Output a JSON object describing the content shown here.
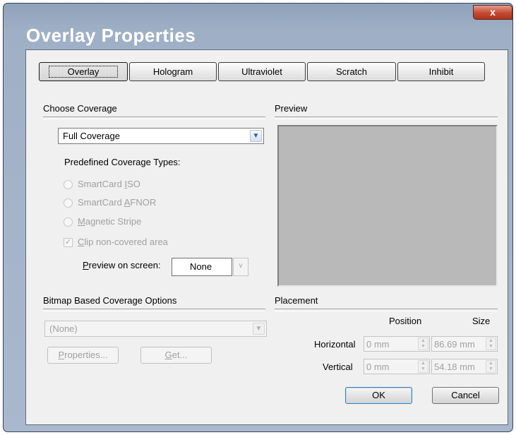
{
  "window": {
    "title": "Overlay Properties",
    "close_glyph": "x"
  },
  "tabs": [
    {
      "label": "Overlay",
      "active": true
    },
    {
      "label": "Hologram",
      "active": false
    },
    {
      "label": "Ultraviolet",
      "active": false
    },
    {
      "label": "Scratch",
      "active": false
    },
    {
      "label": "Inhibit",
      "active": false
    }
  ],
  "coverage": {
    "heading": "Choose Coverage",
    "selected": "Full Coverage",
    "predefined_label": "Predefined Coverage Types:",
    "radios": [
      {
        "pre": "SmartCard ",
        "key": "I",
        "post": "SO"
      },
      {
        "pre": "SmartCard ",
        "key": "A",
        "post": "FNOR"
      },
      {
        "pre": "",
        "key": "M",
        "post": "agnetic Stripe"
      }
    ],
    "clip": {
      "pre": "",
      "key": "C",
      "post": "lip non-covered area",
      "checked": true
    },
    "preview_on_screen": {
      "pre": "",
      "key": "P",
      "post": "review on screen:",
      "value": "None"
    }
  },
  "preview": {
    "heading": "Preview",
    "background": "#b9b9b9"
  },
  "bitmap": {
    "heading": "Bitmap Based Coverage Options",
    "selected": "(None)",
    "properties_btn": {
      "pre": "",
      "key": "P",
      "post": "roperties..."
    },
    "get_btn": {
      "pre": "",
      "key": "G",
      "post": "et..."
    }
  },
  "placement": {
    "heading": "Placement",
    "col_position": "Position",
    "col_size": "Size",
    "horizontal_label": "Horizontal",
    "horizontal_position": "0 mm",
    "horizontal_size": "86.69 mm",
    "vertical_label": "Vertical",
    "vertical_position": "0 mm",
    "vertical_size": "54.18 mm"
  },
  "buttons": {
    "ok": "OK",
    "cancel": "Cancel"
  },
  "icons": {
    "dropdown": "chevron-down-icon",
    "spinner": "spinner-arrows-icon",
    "check": "checkmark-icon"
  },
  "colors": {
    "title_bar": "#9fb0c6",
    "close": "#c44a32",
    "dialog_bg": "#f0f0f0"
  }
}
